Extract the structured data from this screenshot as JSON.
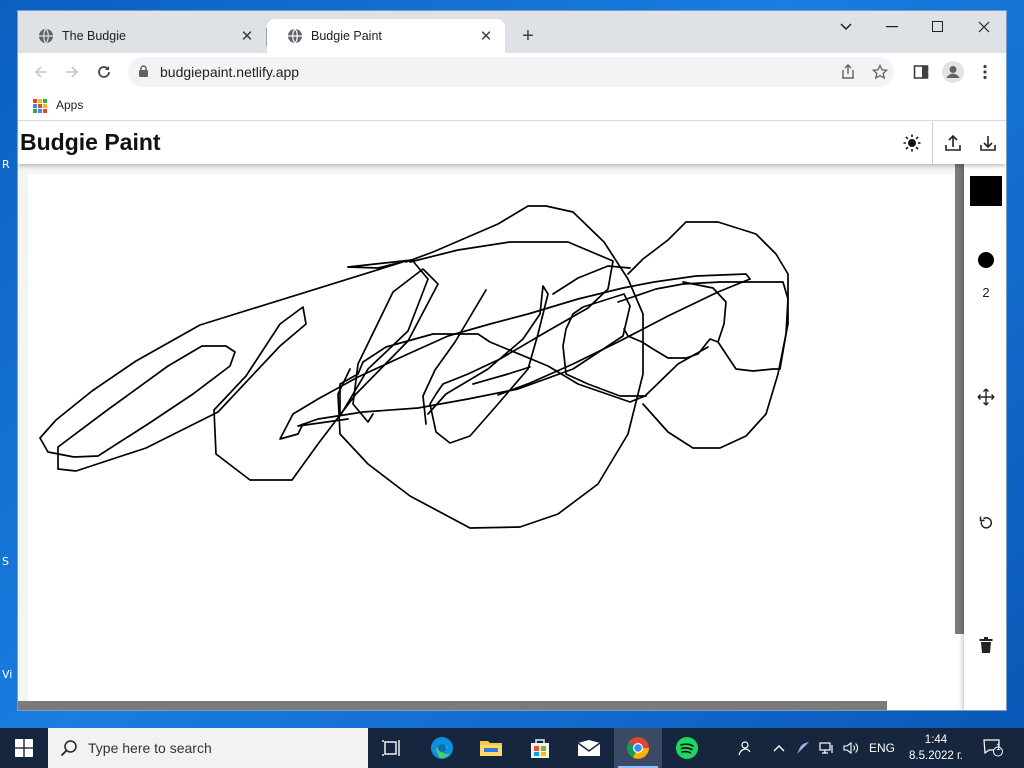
{
  "browser": {
    "tabs": [
      {
        "title": "The Budgie",
        "active": false
      },
      {
        "title": "Budgie Paint",
        "active": true
      }
    ],
    "address": "budgiepaint.netlify.app",
    "bookmarks": [
      {
        "label": "Apps"
      }
    ]
  },
  "app": {
    "title": "Budgie Paint",
    "tools": {
      "color": "#000000",
      "brush_size": "2"
    }
  },
  "taskbar": {
    "search_placeholder": "Type here to search",
    "language": "ENG",
    "time": "1:44",
    "date": "8.5.2022 г.",
    "notification_count": "1"
  },
  "desktop": {
    "fragments": [
      "R",
      "S",
      "Vi"
    ]
  },
  "colors": {
    "desktop": "#0b5fbf",
    "taskbar": "#16263f",
    "tabstrip": "#dee1e6",
    "ink": "#000000"
  }
}
